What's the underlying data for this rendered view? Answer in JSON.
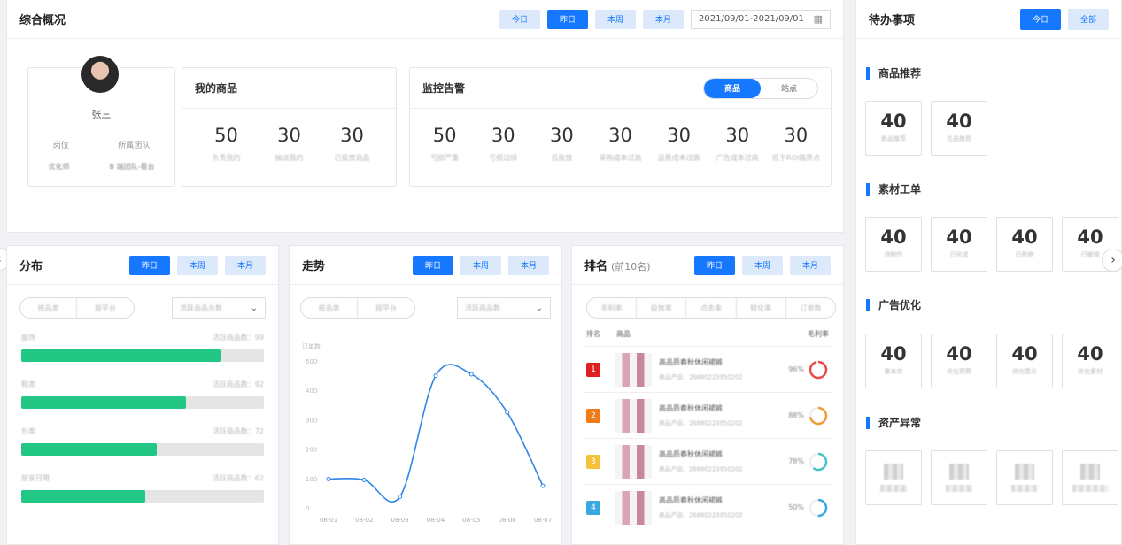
{
  "overview": {
    "title": "综合概况",
    "tabs": [
      "今日",
      "昨日",
      "本周",
      "本月"
    ],
    "active_tab": 1,
    "date_range": "2021/09/01-2021/09/01",
    "user": {
      "name": "张三",
      "labels": [
        "岗位",
        "所属团队"
      ],
      "values": [
        "优化师",
        "B 端团队-看台"
      ]
    },
    "my_goods": {
      "title": "我的商品",
      "items": [
        {
          "value": "50",
          "label": "负责我的"
        },
        {
          "value": "30",
          "label": "抽派我的"
        },
        {
          "value": "30",
          "label": "已投放商品"
        }
      ]
    },
    "monitor": {
      "title": "监控告警",
      "toggle": [
        "商品",
        "站点"
      ],
      "items": [
        {
          "value": "50",
          "label": "亏损严重"
        },
        {
          "value": "30",
          "label": "亏损边缘"
        },
        {
          "value": "30",
          "label": "低投放"
        },
        {
          "value": "30",
          "label": "采购成本过高"
        },
        {
          "value": "30",
          "label": "运费成本过高"
        },
        {
          "value": "30",
          "label": "广告成本过高"
        },
        {
          "value": "30",
          "label": "低于ROI临界点"
        }
      ]
    }
  },
  "distribution": {
    "title": "分布",
    "tabs": [
      "昨日",
      "本周",
      "本月"
    ],
    "segments": [
      "按品类",
      "按平台"
    ],
    "select": "活跃商品总数",
    "bars": [
      {
        "label": "服饰",
        "meta": "活跃商品数：99",
        "pct": 0.82
      },
      {
        "label": "鞋类",
        "meta": "活跃商品数：92",
        "pct": 0.68
      },
      {
        "label": "包类",
        "meta": "活跃商品数：72",
        "pct": 0.56
      },
      {
        "label": "居家日用",
        "meta": "活跃商品数：62",
        "pct": 0.51
      }
    ]
  },
  "trend": {
    "title": "走势",
    "tabs": [
      "昨日",
      "本周",
      "本月"
    ],
    "segments": [
      "按品类",
      "按平台"
    ],
    "select": "活跃商品数",
    "ylabel": "订单数",
    "chart_data": {
      "type": "line",
      "x": [
        "08-01",
        "08-02",
        "08-03",
        "08-04",
        "08-05",
        "08-06",
        "08-07"
      ],
      "series": [
        {
          "values": [
            98,
            95,
            38,
            450,
            455,
            325,
            75
          ]
        }
      ],
      "ylim": [
        0,
        500
      ],
      "yticks": [
        "0",
        "100",
        "200",
        "300",
        "400",
        "500"
      ],
      "color": "#2f86e6"
    }
  },
  "ranking": {
    "title": "排名",
    "subtitle": "(前10名)",
    "tabs": [
      "昨日",
      "本周",
      "本月"
    ],
    "segments": [
      "毛利率",
      "投放率",
      "点击率",
      "转化率",
      "订单数"
    ],
    "cols": [
      "排名",
      "商品",
      "毛利率"
    ],
    "rows": [
      {
        "rank": "1",
        "color": "#e02020",
        "name": "高品质春秋休闲裙裤",
        "code": "商品产品：26880223950202",
        "pct": "96%",
        "ratio": 0.96,
        "ring": "#e84a4a"
      },
      {
        "rank": "2",
        "color": "#f07b1a",
        "name": "高品质春秋休闲裙裤",
        "code": "商品产品：26880223950202",
        "pct": "88%",
        "ratio": 0.72,
        "ring": "#f39b35"
      },
      {
        "rank": "3",
        "color": "#f5c33b",
        "name": "高品质春秋休闲裙裤",
        "code": "商品产品：26880223950202",
        "pct": "78%",
        "ratio": 0.6,
        "ring": "#43c3c9"
      },
      {
        "rank": "4",
        "color": "#3aa8e0",
        "name": "高品质春秋休闲裙裤",
        "code": "商品产品：26880223950202",
        "pct": "50%",
        "ratio": 0.5,
        "ring": "#3aa8e0"
      }
    ]
  },
  "todo": {
    "title": "待办事项",
    "tabs": [
      "今日",
      "全部"
    ],
    "sections": [
      {
        "title": "商品推荐",
        "items": [
          {
            "value": "40",
            "label": "新品推荐"
          },
          {
            "value": "40",
            "label": "在品推荐"
          }
        ]
      },
      {
        "title": "素材工单",
        "items": [
          {
            "value": "40",
            "label": "待制作"
          },
          {
            "value": "40",
            "label": "已完成"
          },
          {
            "value": "40",
            "label": "已拒绝"
          },
          {
            "value": "40",
            "label": "已撤销"
          }
        ]
      },
      {
        "title": "广告优化",
        "items": [
          {
            "value": "40",
            "label": "重未优"
          },
          {
            "value": "40",
            "label": "优化预算"
          },
          {
            "value": "40",
            "label": "优化受众"
          },
          {
            "value": "40",
            "label": "优化素材"
          }
        ]
      },
      {
        "title": "资产异常",
        "items": [
          {
            "value": ""
          },
          {
            "value": ""
          },
          {
            "value": ""
          },
          {
            "value": ""
          }
        ]
      }
    ]
  }
}
